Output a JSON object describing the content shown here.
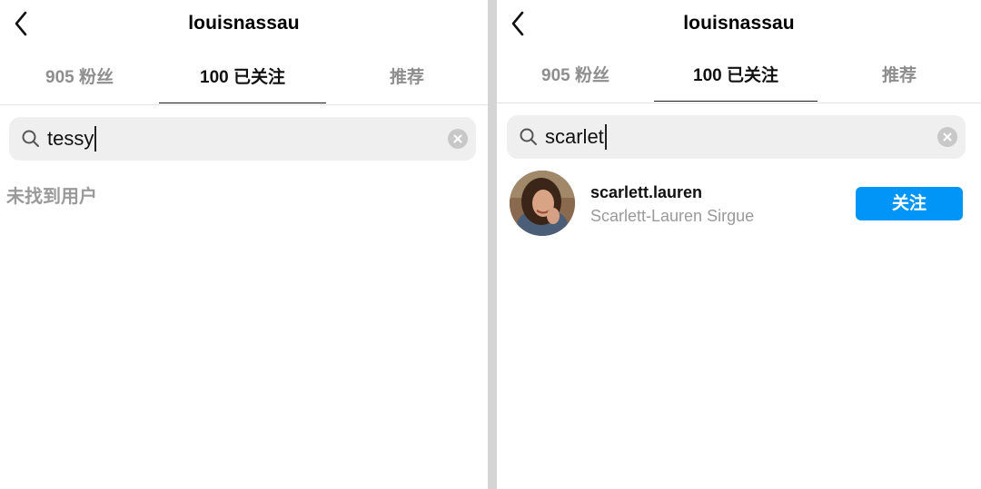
{
  "left": {
    "title": "louisnassau",
    "tabs": [
      {
        "label": "905 粉丝"
      },
      {
        "label": "100 已关注"
      },
      {
        "label": "推荐"
      }
    ],
    "search": {
      "value": "tessy"
    },
    "empty_message": "未找到用户"
  },
  "right": {
    "title": "louisnassau",
    "tabs": [
      {
        "label": "905 粉丝"
      },
      {
        "label": "100 已关注"
      },
      {
        "label": "推荐"
      }
    ],
    "search": {
      "value": "scarlet"
    },
    "result": {
      "username": "scarlett.lauren",
      "full_name": "Scarlett-Lauren Sirgue",
      "follow_label": "关注"
    }
  },
  "icons": {
    "back": "chevron-left-icon",
    "search": "search-icon",
    "clear": "clear-circle-icon"
  },
  "colors": {
    "follow_button": "#0095f6",
    "search_bg": "#efefef",
    "divider": "#d4d4d4"
  }
}
